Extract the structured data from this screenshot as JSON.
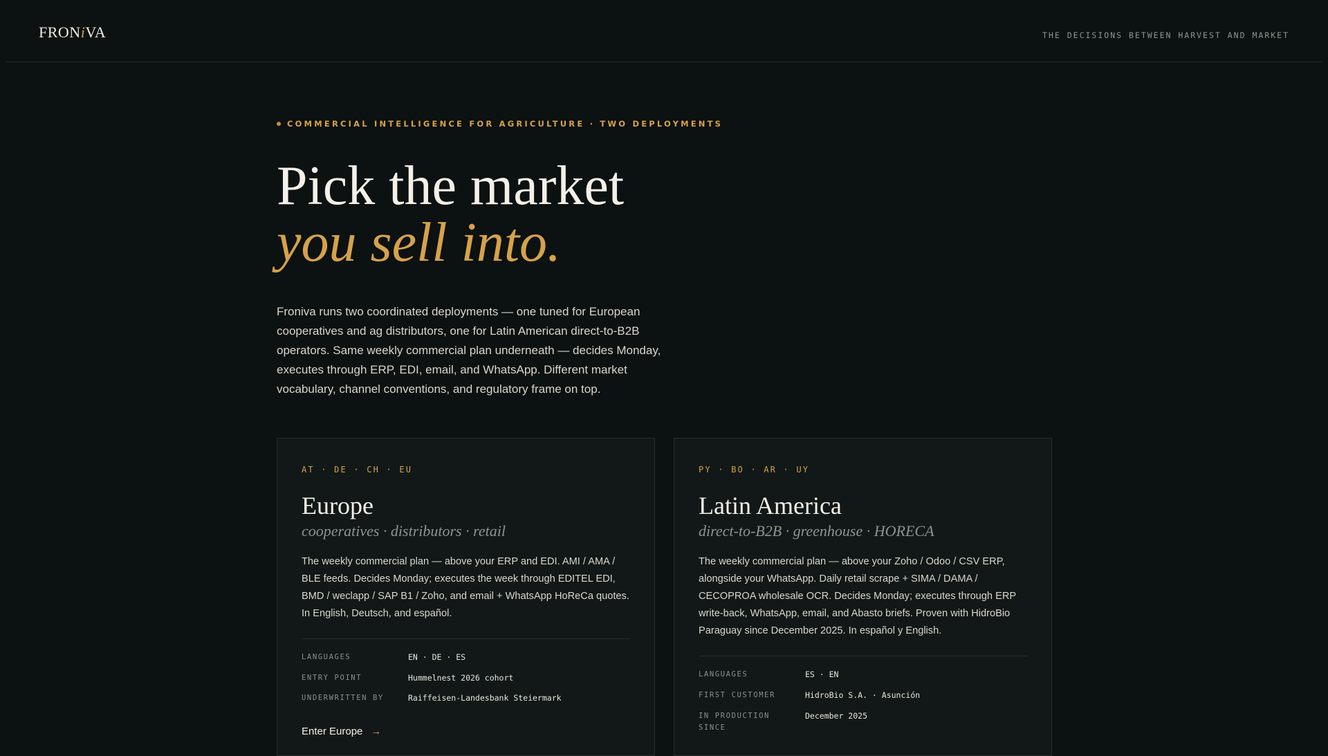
{
  "header": {
    "logo_pre": "FRON",
    "logo_i": "i",
    "logo_post": "VA",
    "tagline": "THE DECISIONS BETWEEN HARVEST AND MARKET"
  },
  "hero": {
    "eyebrow": "COMMERCIAL INTELLIGENCE FOR AGRICULTURE · TWO DEPLOYMENTS",
    "title_line1": "Pick the market",
    "title_line2": "you sell into.",
    "lede": "Froniva runs two coordinated deployments — one tuned for European cooperatives and ag distributors, one for Latin American direct-to-B2B operators. Same weekly commercial plan underneath — decides Monday, executes through ERP, EDI, email, and WhatsApp. Different market vocabulary, channel conventions, and regulatory frame on top."
  },
  "cards": [
    {
      "codes": "AT · DE · CH · EU",
      "region": "Europe",
      "subtitle": "cooperatives · distributors · retail",
      "description": "The weekly commercial plan — above your ERP and EDI. AMI / AMA / BLE feeds. Decides Monday; executes the week through EDITEL EDI, BMD / weclapp / SAP B1 / Zoho, and email + WhatsApp HoReCa quotes. In English, Deutsch, and español.",
      "meta": [
        {
          "key": "LANGUAGES",
          "value": "EN · DE · ES"
        },
        {
          "key": "ENTRY POINT",
          "value": "Hummelnest 2026 cohort"
        },
        {
          "key": "UNDERWRITTEN BY",
          "value": "Raiffeisen-Landesbank Steiermark"
        }
      ],
      "cta": "Enter Europe",
      "cta_arrow": "→"
    },
    {
      "codes": "PY · BO · AR · UY",
      "region": "Latin America",
      "subtitle": "direct-to-B2B · greenhouse · HORECA",
      "description": "The weekly commercial plan — above your Zoho / Odoo / CSV ERP, alongside your WhatsApp. Daily retail scrape + SIMA / DAMA / CECOPROA wholesale OCR. Decides Monday; executes through ERP write-back, WhatsApp, email, and Abasto briefs. Proven with HidroBio Paraguay since December 2025. In español y English.",
      "meta": [
        {
          "key": "LANGUAGES",
          "value": "ES · EN"
        },
        {
          "key": "FIRST CUSTOMER",
          "value": "HidroBio S.A. · Asunción"
        },
        {
          "key": "IN PRODUCTION SINCE",
          "value": "December 2025"
        }
      ]
    }
  ]
}
